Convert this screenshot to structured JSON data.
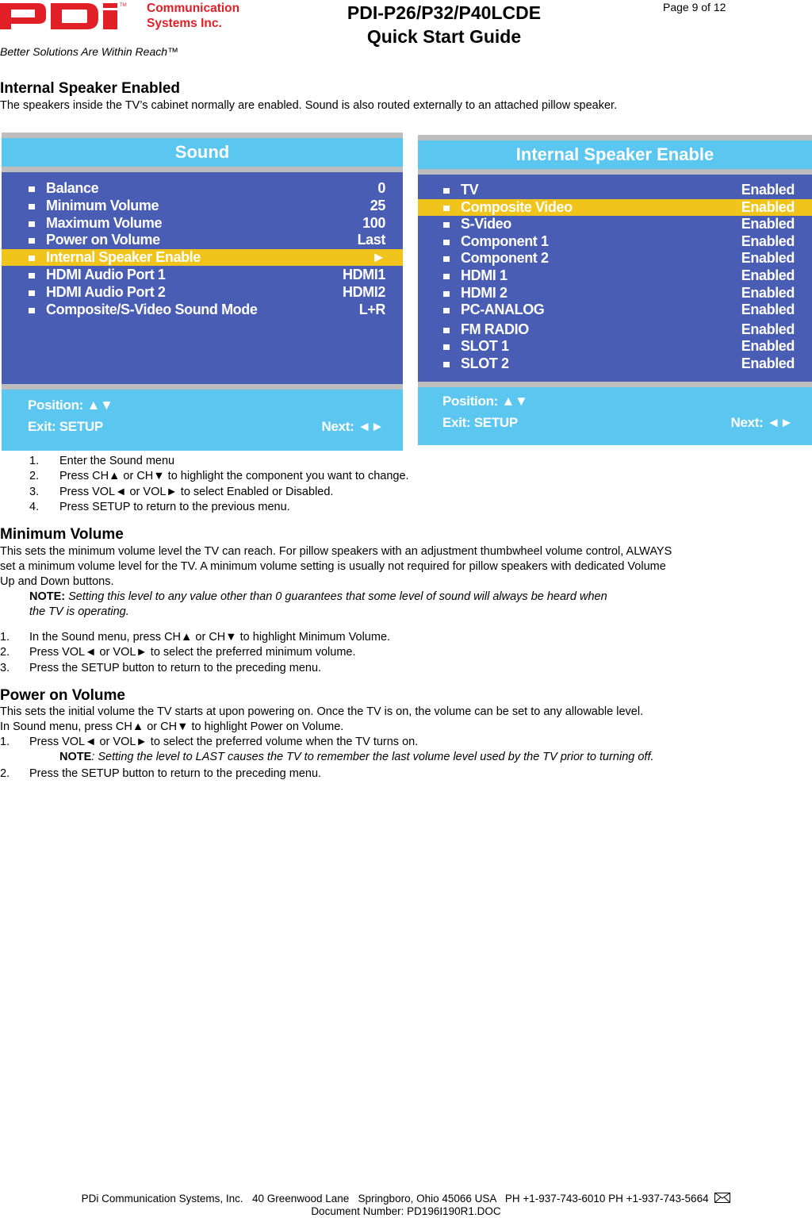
{
  "header": {
    "logo_text": "PDi",
    "trademark": "TM",
    "company_line1": "Communication",
    "company_line2": "Systems Inc.",
    "doc_title_line1": "PDI-P26/P32/P40LCDE",
    "doc_title_line2": "Quick Start Guide",
    "page": "Page 9 of 12",
    "tagline": "Better Solutions Are Within Reach™"
  },
  "colors": {
    "brand_red": "#e01f26",
    "menu_title_bg": "#5bc6f0",
    "menu_body_bg": "#4a5db4",
    "menu_highlight": "#f0c41a",
    "menu_separator": "#bdbdbd"
  },
  "section1": {
    "title": "Internal Speaker Enabled",
    "body": "The speakers inside the TV’s cabinet normally are enabled. Sound is also routed externally to an attached pillow speaker.",
    "steps": [
      {
        "num": "1.",
        "text": "Enter the Sound menu"
      },
      {
        "num": "2.",
        "text": "Press CH▲ or CH▼ to highlight the component you want to change."
      },
      {
        "num": "3.",
        "text": "Press VOL◄ or VOL► to select Enabled or Disabled."
      },
      {
        "num": "4.",
        "text": "Press SETUP to return to the previous menu."
      }
    ]
  },
  "sound_menu": {
    "title": "Sound",
    "items": [
      {
        "label": "Balance",
        "value": "0"
      },
      {
        "label": "Minimum Volume",
        "value": "25"
      },
      {
        "label": "Maximum Volume",
        "value": "100"
      },
      {
        "label": "Power on Volume",
        "value": "Last"
      },
      {
        "label": "Internal Speaker Enable",
        "value": "►",
        "selected": true
      },
      {
        "label": "HDMI Audio Port 1",
        "value": "HDMI1"
      },
      {
        "label": "HDMI Audio Port 2",
        "value": "HDMI2"
      },
      {
        "label": "Composite/S-Video Sound Mode",
        "value": "L+R"
      }
    ],
    "footer_position": "Position: ▲▼",
    "footer_exit": "Exit: SETUP",
    "footer_next": "Next: ◄►"
  },
  "speaker_menu": {
    "title": "Internal Speaker Enable",
    "items": [
      {
        "label": "TV",
        "value": "Enabled"
      },
      {
        "label": "Composite Video",
        "value": "Enabled",
        "selected": true
      },
      {
        "label": "S-Video",
        "value": "Enabled"
      },
      {
        "label": "Component 1",
        "value": "Enabled"
      },
      {
        "label": "Component 2",
        "value": "Enabled"
      },
      {
        "label": "HDMI 1",
        "value": "Enabled"
      },
      {
        "label": "HDMI 2",
        "value": "Enabled"
      },
      {
        "label": "PC-ANALOG",
        "value": "Enabled"
      },
      {
        "label": "FM RADIO",
        "value": "Enabled"
      },
      {
        "label": "SLOT 1",
        "value": "Enabled"
      },
      {
        "label": "SLOT 2",
        "value": "Enabled"
      }
    ],
    "footer_position": "Position: ▲▼",
    "footer_exit": "Exit: SETUP",
    "footer_next": "Next: ◄►"
  },
  "section2": {
    "title": "Minimum Volume",
    "body_line1": "This sets the minimum volume level the TV can reach. For pillow speakers with an adjustment thumbwheel volume control, ALWAYS",
    "body_line2": "set a minimum volume level for the TV. A minimum volume setting is usually not required for pillow speakers with dedicated Volume",
    "body_line3": "Up and Down buttons.",
    "note_label": "NOTE:",
    "note_line1": " Setting this level to any value other than 0 guarantees that some level of sound will always be heard when",
    "note_line2": "the TV is operating.",
    "steps": [
      {
        "num": "1.",
        "text": "In the Sound menu, press CH▲ or CH▼ to highlight Minimum Volume."
      },
      {
        "num": "2.",
        "text": "Press VOL◄ or VOL► to select the preferred minimum volume."
      },
      {
        "num": "3.",
        "text": "Press the SETUP button to return to the preceding menu."
      }
    ]
  },
  "section3": {
    "title": "Power on Volume",
    "body_line1": "This sets the initial volume the TV starts at upon powering on. Once the TV is on, the volume can be set to any allowable level.",
    "body_line2": "In Sound menu, press CH▲ or CH▼ to highlight Power on Volume.",
    "step1_num": "1.",
    "step1_text": "Press VOL◄ or VOL► to select the preferred volume when the TV turns on.",
    "note_label": "NOTE",
    "note_text": ": Setting the level to LAST causes the TV to remember the last volume level used by the TV prior to turning off.",
    "step2_num": "2.",
    "step2_text": "Press the SETUP button to return to the preceding menu."
  },
  "footer": {
    "address": "PDi Communication Systems, Inc.   40 Greenwood Lane   Springboro, Ohio 45066 USA   PH +1-937-743-6010 PH +1-937-743-5664",
    "doc_number": "Document Number:  PD196I190R1.DOC",
    "mail_icon": "envelope-icon"
  }
}
